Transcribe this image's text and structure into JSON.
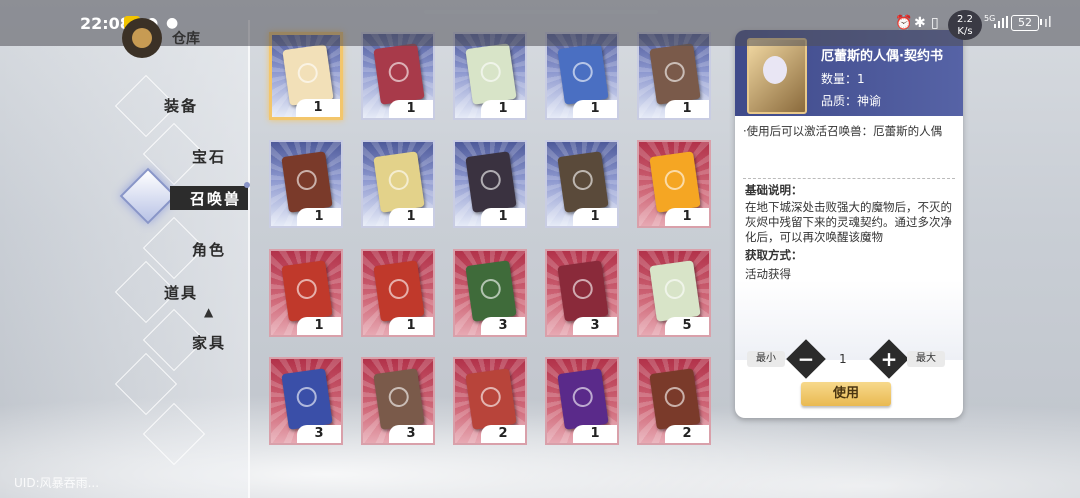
{
  "status_bar": {
    "time": "22:08",
    "net_speed": "2.2\nK/s",
    "net_type": "5G",
    "battery": "52"
  },
  "category": {
    "title": "仓库"
  },
  "nav": {
    "items": [
      {
        "label": "装备"
      },
      {
        "label": "宝石"
      },
      {
        "label": "召唤兽"
      },
      {
        "label": "角色"
      },
      {
        "label": "道具"
      },
      {
        "label": "家具"
      }
    ]
  },
  "uid_label": "UID:风暴吞雨...",
  "grid": {
    "rows": [
      [
        {
          "count": "1",
          "bg": "blue",
          "color": "#f2e0b8",
          "selected": true
        },
        {
          "count": "1",
          "bg": "blue",
          "color": "#a83a4a"
        },
        {
          "count": "1",
          "bg": "blue",
          "color": "#d8e4c8"
        },
        {
          "count": "1",
          "bg": "blue",
          "color": "#4a6fc2"
        },
        {
          "count": "1",
          "bg": "blue",
          "color": "#7a5a4a"
        }
      ],
      [
        {
          "count": "1",
          "bg": "blue",
          "color": "#7a3a2a"
        },
        {
          "count": "1",
          "bg": "blue",
          "color": "#e3d28a"
        },
        {
          "count": "1",
          "bg": "blue",
          "color": "#3a3240"
        },
        {
          "count": "1",
          "bg": "blue",
          "color": "#5a4a3a"
        },
        {
          "count": "1",
          "bg": "red",
          "color": "#f5a623"
        }
      ],
      [
        {
          "count": "1",
          "bg": "red",
          "color": "#c0392b"
        },
        {
          "count": "1",
          "bg": "red",
          "color": "#c0392b"
        },
        {
          "count": "3",
          "bg": "red",
          "color": "#3f6b3a"
        },
        {
          "count": "3",
          "bg": "red",
          "color": "#8a2a3a"
        },
        {
          "count": "5",
          "bg": "red",
          "color": "#d8e4c8"
        }
      ],
      [
        {
          "count": "3",
          "bg": "red",
          "color": "#3a4fa8"
        },
        {
          "count": "3",
          "bg": "red",
          "color": "#7a5a4a"
        },
        {
          "count": "2",
          "bg": "red",
          "color": "#b8443a"
        },
        {
          "count": "1",
          "bg": "red",
          "color": "#5a2a8a"
        },
        {
          "count": "2",
          "bg": "red",
          "color": "#7a3a2a"
        }
      ]
    ]
  },
  "detail": {
    "name": "厄蕾斯的人偶·契约书",
    "quantity": "数量：1",
    "quality": "品质：神谕",
    "desc": "·使用后可以激活召唤兽：厄蕾斯的人偶",
    "basic_title": "基础说明：",
    "basic_text": "在地下城深处击败强大的魔物后，不灭的灰烬中残留下来的灵魂契约。通过多次净化后，可以再次唤醒该魔物",
    "source_title": "获取方式：",
    "source_text": "活动获得",
    "min_label": "最小",
    "max_label": "最大",
    "qty_value": "1",
    "use_label": "使用"
  }
}
